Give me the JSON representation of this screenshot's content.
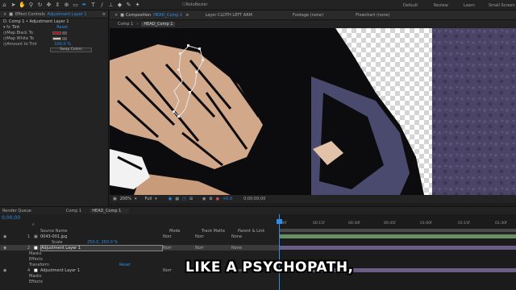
{
  "toolbar": {
    "roto_label": "RotoBezier",
    "workspaces": [
      "Default",
      "Review",
      "Learn",
      "Small Screen"
    ]
  },
  "effect_controls": {
    "tab_prefix": "Effect Controls",
    "tab_layer": "Adjustment Layer 1",
    "breadcrumb": "D. Comp 1 • Adjustment Layer 1",
    "effect_name": "Tint",
    "reset_label": "Reset",
    "map_black_label": "Map Black To",
    "map_white_label": "Map White To",
    "amount_label": "Amount to Tint",
    "amount_value": "100.0 %",
    "swap_label": "Swap Colors",
    "black_color": "#b0121b",
    "white_color": "#c8c3b4"
  },
  "composition": {
    "tab_prefix": "Composition",
    "tab_name": "HEAD_Comp 1",
    "layer_tab": "Layer CLOTH LEFT ARM",
    "footage_tab": "Footage (none)",
    "flowchart_tab": "Flowchart (none)",
    "breadcrumbs": [
      "Comp 1",
      "HEAD_Comp 1"
    ],
    "zoom": "200%",
    "resolution": "Full",
    "exposure": "+0.0",
    "timecode": "0;00;00;00"
  },
  "timeline": {
    "render_queue_tab": "Render Queue",
    "comp_tab": "Comp 1",
    "head_tab": "HEAD_Comp 1",
    "current_time": "0;00;00",
    "search_placeholder": "⌕",
    "columns": {
      "source_name": "Source Name",
      "mode": "Mode",
      "track_matte": "Track Matte",
      "parent": "Parent & Link"
    },
    "ruler": [
      "00f",
      "00:15f",
      "00:30f",
      "00:45f",
      "01:00f",
      "01:15f",
      "01:30f"
    ],
    "layers": [
      {
        "num": "1",
        "name": "0043-001.jpg",
        "mode": "Norr",
        "matte": "Norr",
        "parent": "None"
      },
      {
        "prop": "Scale",
        "value": "250.0, 250.0 %"
      },
      {
        "num": "2",
        "name": "Adjustment Layer 1",
        "mode": "Norr",
        "matte": "Norr",
        "parent": "None"
      },
      {
        "prop": "Masks"
      },
      {
        "prop": "Effects"
      },
      {
        "prop": "Transform",
        "value": "Reset"
      },
      {
        "num": "4",
        "name": "Adjustment Layer 1",
        "mode": "Norr",
        "matte": "Norr",
        "parent": "None"
      },
      {
        "prop": "Masks"
      },
      {
        "prop": "Effects"
      }
    ]
  },
  "caption": "LIKE A PSYCHOPATH,",
  "colors": {
    "accent": "#2d8ceb",
    "timeline_green": "#6a8f62",
    "timeline_purple": "#6b5d86",
    "playhead": "#2d8ceb"
  }
}
